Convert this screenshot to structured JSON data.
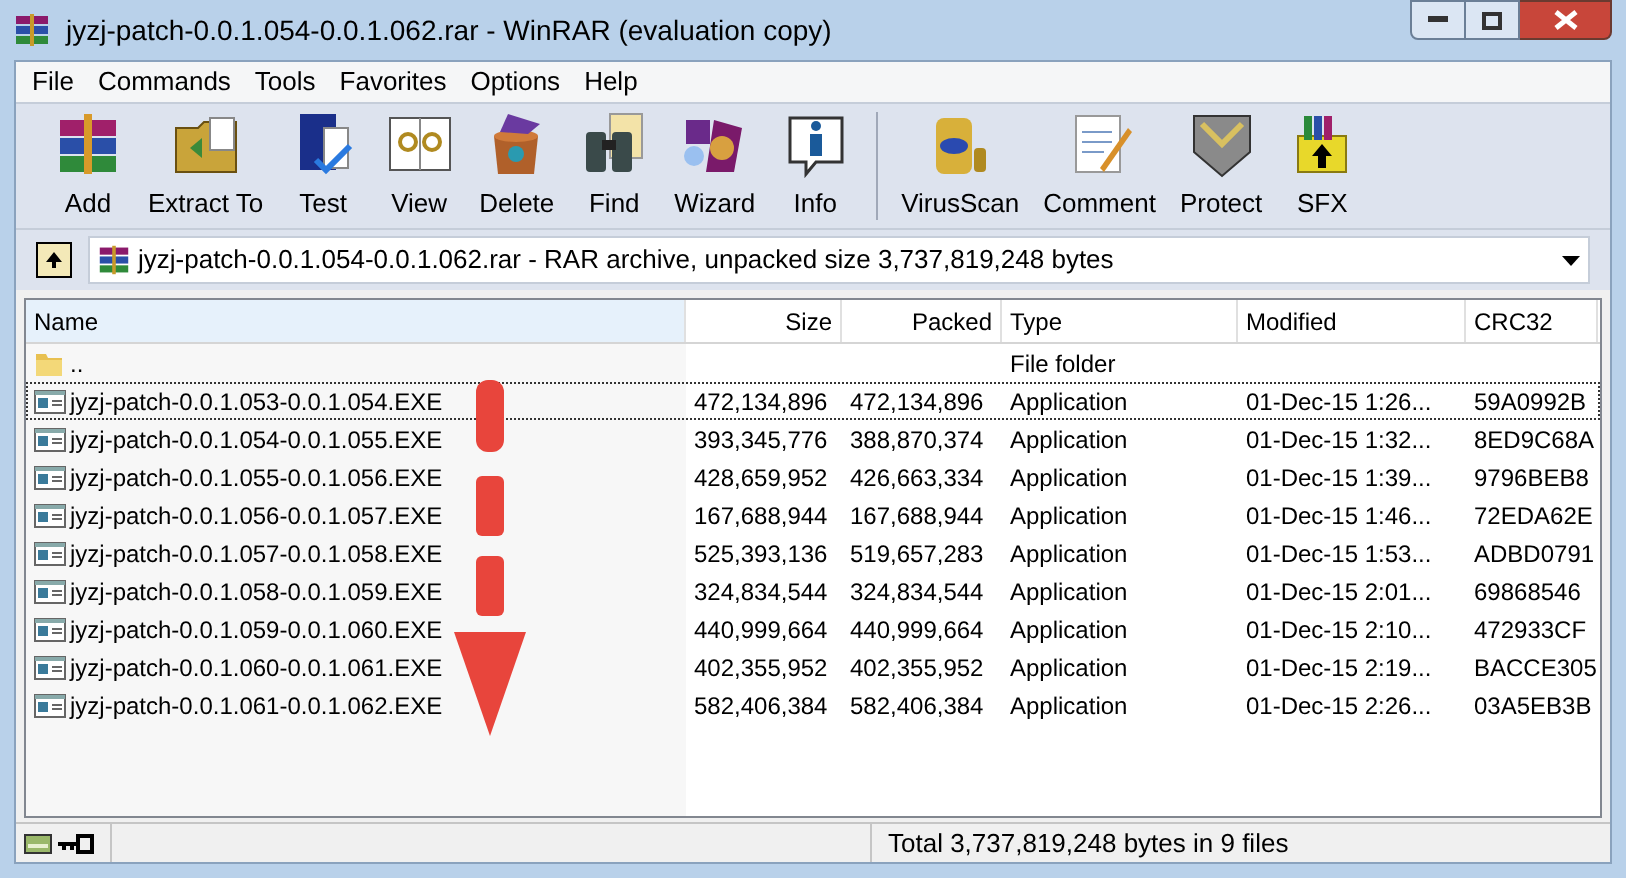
{
  "window": {
    "title": "jyzj-patch-0.0.1.054-0.0.1.062.rar - WinRAR (evaluation copy)"
  },
  "menu": [
    "File",
    "Commands",
    "Tools",
    "Favorites",
    "Options",
    "Help"
  ],
  "toolbar": [
    {
      "label": "Add"
    },
    {
      "label": "Extract To"
    },
    {
      "label": "Test"
    },
    {
      "label": "View"
    },
    {
      "label": "Delete"
    },
    {
      "label": "Find"
    },
    {
      "label": "Wizard"
    },
    {
      "label": "Info"
    },
    {
      "label": "VirusScan"
    },
    {
      "label": "Comment"
    },
    {
      "label": "Protect"
    },
    {
      "label": "SFX"
    }
  ],
  "address": "jyzj-patch-0.0.1.054-0.0.1.062.rar - RAR archive, unpacked size 3,737,819,248 bytes",
  "table": {
    "columns": [
      "Name",
      "Size",
      "Packed",
      "Type",
      "Modified",
      "CRC32"
    ],
    "rows": [
      {
        "kind": "folder",
        "focused": false,
        "cells": [
          "..",
          "",
          "",
          "File folder",
          "",
          ""
        ]
      },
      {
        "kind": "file",
        "focused": true,
        "cells": [
          "jyzj-patch-0.0.1.053-0.0.1.054.EXE",
          "472,134,896",
          "472,134,896",
          "Application",
          "01-Dec-15 1:26...",
          "59A0992B"
        ]
      },
      {
        "kind": "file",
        "focused": false,
        "cells": [
          "jyzj-patch-0.0.1.054-0.0.1.055.EXE",
          "393,345,776",
          "388,870,374",
          "Application",
          "01-Dec-15 1:32...",
          "8ED9C68A"
        ]
      },
      {
        "kind": "file",
        "focused": false,
        "cells": [
          "jyzj-patch-0.0.1.055-0.0.1.056.EXE",
          "428,659,952",
          "426,663,334",
          "Application",
          "01-Dec-15 1:39...",
          "9796BEB8"
        ]
      },
      {
        "kind": "file",
        "focused": false,
        "cells": [
          "jyzj-patch-0.0.1.056-0.0.1.057.EXE",
          "167,688,944",
          "167,688,944",
          "Application",
          "01-Dec-15 1:46...",
          "72EDA62E"
        ]
      },
      {
        "kind": "file",
        "focused": false,
        "cells": [
          "jyzj-patch-0.0.1.057-0.0.1.058.EXE",
          "525,393,136",
          "519,657,283",
          "Application",
          "01-Dec-15 1:53...",
          "ADBD0791"
        ]
      },
      {
        "kind": "file",
        "focused": false,
        "cells": [
          "jyzj-patch-0.0.1.058-0.0.1.059.EXE",
          "324,834,544",
          "324,834,544",
          "Application",
          "01-Dec-15 2:01...",
          "69868546"
        ]
      },
      {
        "kind": "file",
        "focused": false,
        "cells": [
          "jyzj-patch-0.0.1.059-0.0.1.060.EXE",
          "440,999,664",
          "440,999,664",
          "Application",
          "01-Dec-15 2:10...",
          "472933CF"
        ]
      },
      {
        "kind": "file",
        "focused": false,
        "cells": [
          "jyzj-patch-0.0.1.060-0.0.1.061.EXE",
          "402,355,952",
          "402,355,952",
          "Application",
          "01-Dec-15 2:19...",
          "BACCE305"
        ]
      },
      {
        "kind": "file",
        "focused": false,
        "cells": [
          "jyzj-patch-0.0.1.061-0.0.1.062.EXE",
          "582,406,384",
          "582,406,384",
          "Application",
          "01-Dec-15 2:26...",
          "03A5EB3B"
        ]
      }
    ]
  },
  "status_bar": {
    "text": "Total 3,737,819,248 bytes in 9 files"
  }
}
